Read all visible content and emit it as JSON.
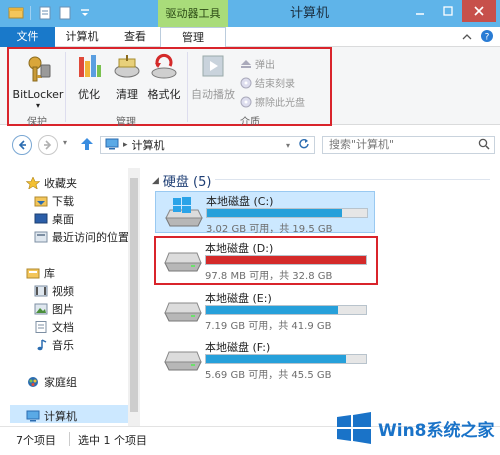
{
  "title_bar": {
    "context_tab": "驱动器工具",
    "window_title": "计算机"
  },
  "tabs": {
    "file": "文件",
    "computer": "计算机",
    "view": "查看",
    "manage": "管理"
  },
  "ribbon": {
    "bitlocker": "BitLocker",
    "optimize": "优化",
    "cleanup": "清理",
    "format": "格式化",
    "autoplay": "自动播放",
    "eject": "弹出",
    "end_burn": "结束刻录",
    "erase_disc": "擦除此光盘",
    "group_protect": "保护",
    "group_manage": "管理",
    "group_media": "介质"
  },
  "address": {
    "path": "计算机",
    "search_placeholder": "搜索\"计算机\""
  },
  "nav": {
    "favorites": "收藏夹",
    "downloads": "下载",
    "desktop": "桌面",
    "recent": "最近访问的位置",
    "libraries": "库",
    "videos": "视频",
    "pictures": "图片",
    "documents": "文档",
    "music": "音乐",
    "homegroup": "家庭组",
    "computer": "计算机"
  },
  "content": {
    "section_title": "硬盘 (5)",
    "drives": [
      {
        "name": "本地磁盘 (C:)",
        "info": "3.02 GB 可用，共 19.5 GB",
        "used_fraction": 0.845,
        "color": "#26a0da",
        "os_drive": true
      },
      {
        "name": "本地磁盘 (D:)",
        "info": "97.8 MB 可用，共 32.8 GB",
        "used_fraction": 0.997,
        "color": "#d42a2a",
        "os_drive": false
      },
      {
        "name": "本地磁盘 (E:)",
        "info": "7.19 GB 可用，共 41.9 GB",
        "used_fraction": 0.828,
        "color": "#26a0da",
        "os_drive": false
      },
      {
        "name": "本地磁盘 (F:)",
        "info": "5.69 GB 可用，共 45.5 GB",
        "used_fraction": 0.875,
        "color": "#26a0da",
        "os_drive": false
      }
    ]
  },
  "status": {
    "items": "7个项目",
    "selected": "选中 1 个项目"
  },
  "watermark": {
    "text": "Win8系统之家"
  }
}
